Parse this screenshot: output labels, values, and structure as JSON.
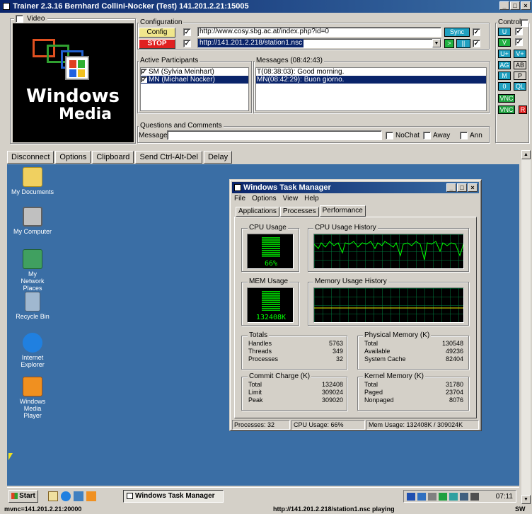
{
  "window": {
    "title": "Trainer 2.3.16 Bernhard Collini-Nocker (Test) 141.201.2.21:15005"
  },
  "video": {
    "label": "Video",
    "logo_line1": "Windows",
    "logo_line2": "Media"
  },
  "configuration": {
    "label": "Configuration",
    "config_button": "Config",
    "stop_button": "STOP",
    "url1": "http://www.cosy.sbg.ac.at/index.php?id=0",
    "url2": "http://141.201.2.218/station1.nsc",
    "sync_button": "Sync"
  },
  "participants": {
    "label": "Active Participants",
    "items": [
      "SM (Sylvia Meinhart)",
      "MN (Michael Nocker)"
    ]
  },
  "messages": {
    "label": "Messages (08:42:43)",
    "items": [
      "T(08:38:03): Good morning.",
      "MN(08:42:29): Buon giorno."
    ]
  },
  "questions": {
    "label": "Questions and Comments",
    "message_label": "Message:",
    "nochat": "NoChat",
    "away": "Away",
    "ann": "Ann"
  },
  "control": {
    "label": "Control",
    "buttons": [
      "U",
      "V",
      "U+",
      "V+",
      "AG",
      "AB",
      "M",
      "P",
      "0",
      "QL",
      "VNC",
      "VNC",
      "R"
    ]
  },
  "toolbar": {
    "disconnect": "Disconnect",
    "options": "Options",
    "clipboard": "Clipboard",
    "send_cad": "Send Ctrl-Alt-Del",
    "delay": "Delay"
  },
  "desktop_icons": [
    "My Documents",
    "My Computer",
    "My Network Places",
    "Recycle Bin",
    "Internet Explorer",
    "Windows Media Player"
  ],
  "task_manager": {
    "title": "Windows Task Manager",
    "menu": [
      "File",
      "Options",
      "View",
      "Help"
    ],
    "tabs": [
      "Applications",
      "Processes",
      "Performance"
    ],
    "cpu_usage_label": "CPU Usage",
    "cpu_usage_value": "66%",
    "cpu_history_label": "CPU Usage History",
    "mem_usage_label": "MEM Usage",
    "mem_usage_value": "132408K",
    "mem_history_label": "Memory Usage History",
    "totals": {
      "label": "Totals",
      "rows": [
        [
          "Handles",
          "5763"
        ],
        [
          "Threads",
          "349"
        ],
        [
          "Processes",
          "32"
        ]
      ]
    },
    "physical": {
      "label": "Physical Memory (K)",
      "rows": [
        [
          "Total",
          "130548"
        ],
        [
          "Available",
          "49236"
        ],
        [
          "System Cache",
          "82404"
        ]
      ]
    },
    "commit": {
      "label": "Commit Charge (K)",
      "rows": [
        [
          "Total",
          "132408"
        ],
        [
          "Limit",
          "309024"
        ],
        [
          "Peak",
          "309020"
        ]
      ]
    },
    "kernel": {
      "label": "Kernel Memory (K)",
      "rows": [
        [
          "Total",
          "31780"
        ],
        [
          "Paged",
          "23704"
        ],
        [
          "Nonpaged",
          "8076"
        ]
      ]
    },
    "status": {
      "processes": "Processes: 32",
      "cpu": "CPU Usage: 66%",
      "mem": "Mem Usage: 132408K / 309024K"
    }
  },
  "taskbar": {
    "start": "Start",
    "task": "Windows Task Manager",
    "clock": "07:11"
  },
  "statusbar": {
    "left": "mvnc=141.201.2.21:20000",
    "center": "http://141.201.2.218/station1.nsc  playing",
    "right": "SW"
  }
}
